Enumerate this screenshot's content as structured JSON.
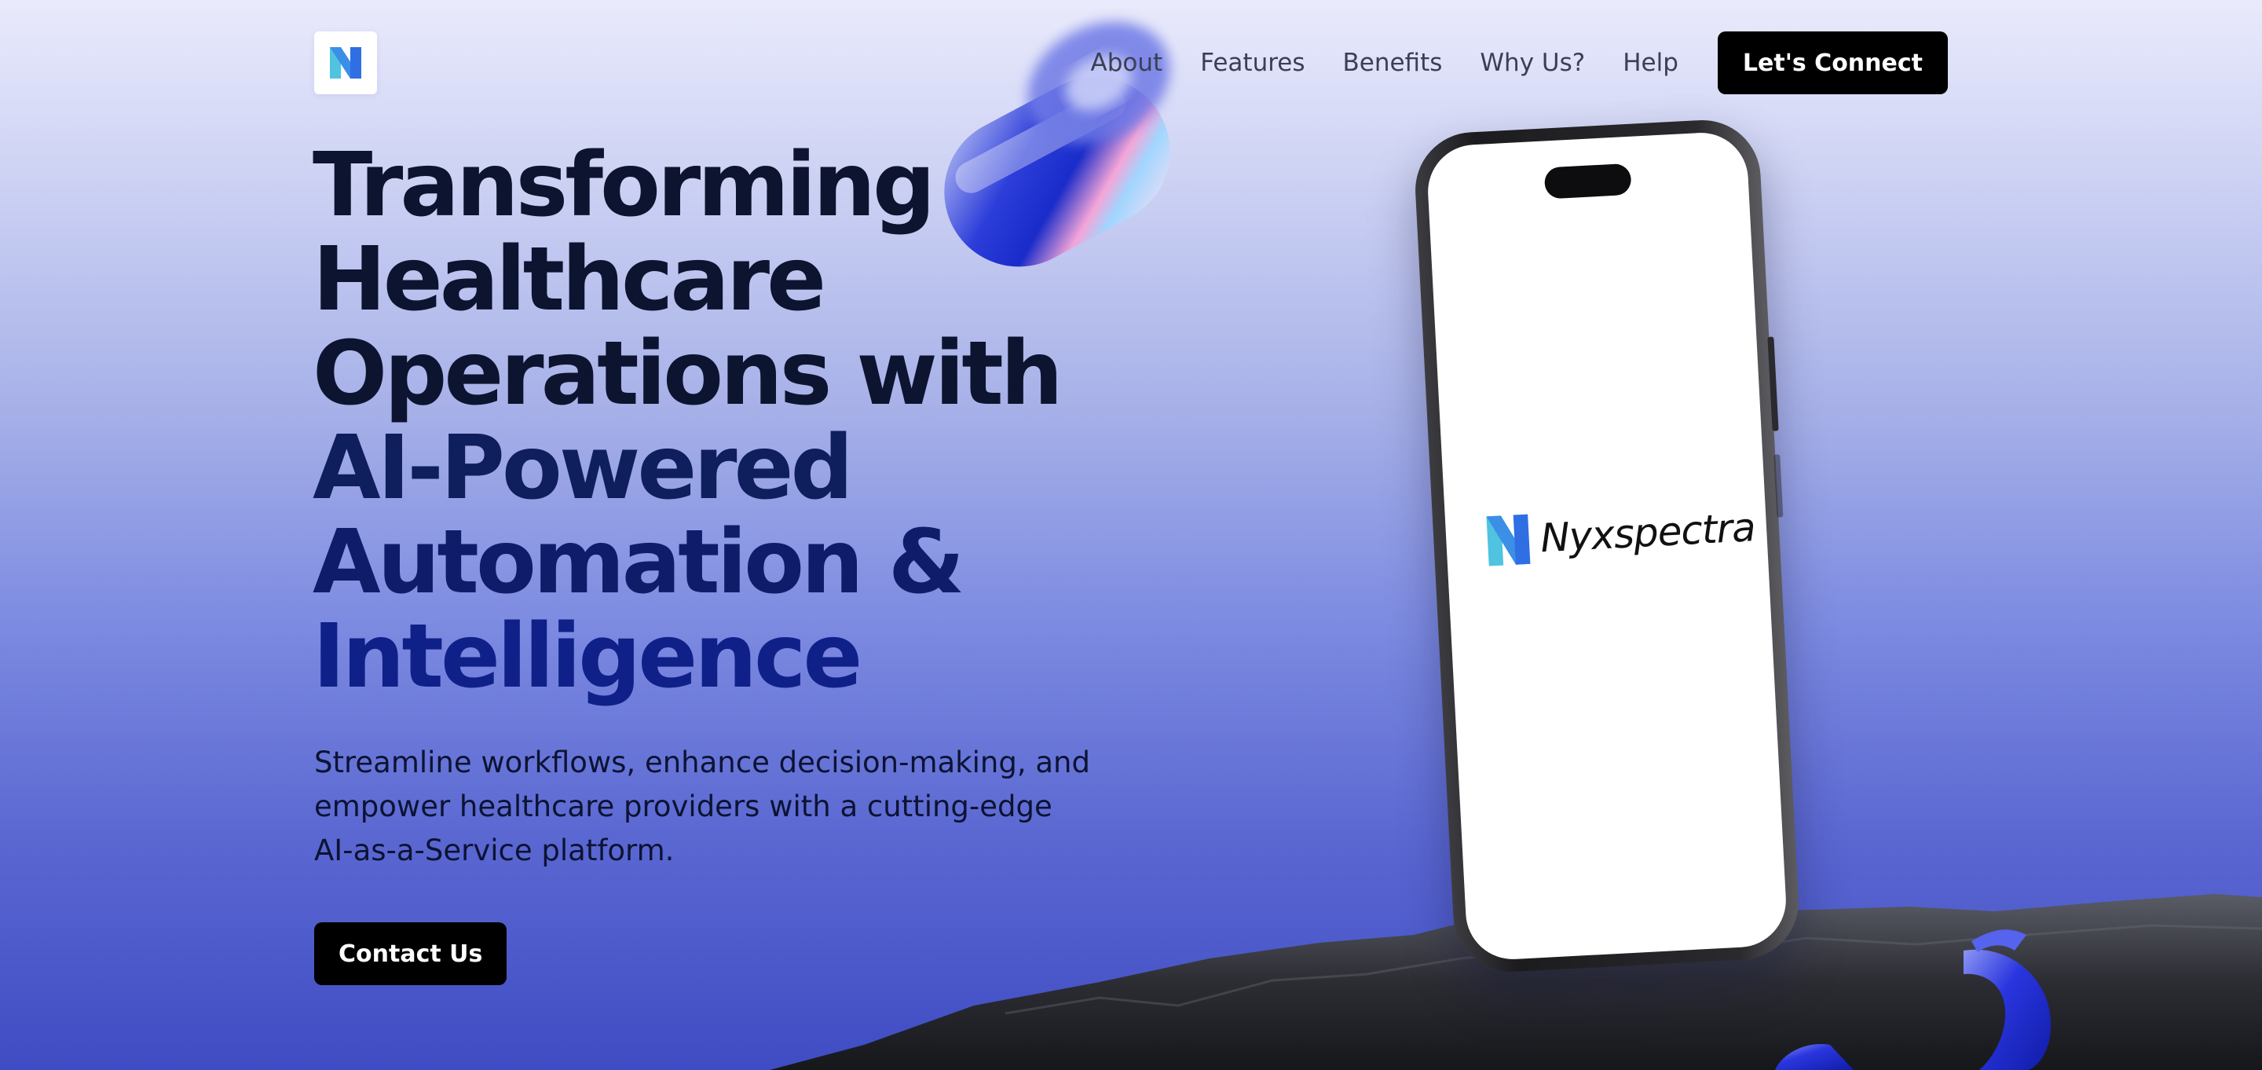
{
  "brand": {
    "name": "Nyxspectra",
    "colors": {
      "logo_teal": "#4fc3e0",
      "logo_blue": "#2f6fe3"
    }
  },
  "nav": {
    "links": [
      "About",
      "Features",
      "Benefits",
      "Why Us?",
      "Help"
    ],
    "cta_label": "Let's Connect"
  },
  "hero": {
    "headline_lines": [
      "Transforming",
      "Healthcare",
      "Operations with",
      "AI-Powered",
      "Automation &",
      "Intelligence"
    ],
    "subcopy": "Streamline workflows, enhance decision-making, and empower healthcare providers with a cutting-edge AI-as-a-Service platform.",
    "cta_label": "Contact Us"
  },
  "colors": {
    "background_top": "#e9eafb",
    "background_bottom": "#3f4cc3",
    "button_bg": "#000000",
    "headline": "#0d1430",
    "headline_accent": "#0f2188"
  }
}
